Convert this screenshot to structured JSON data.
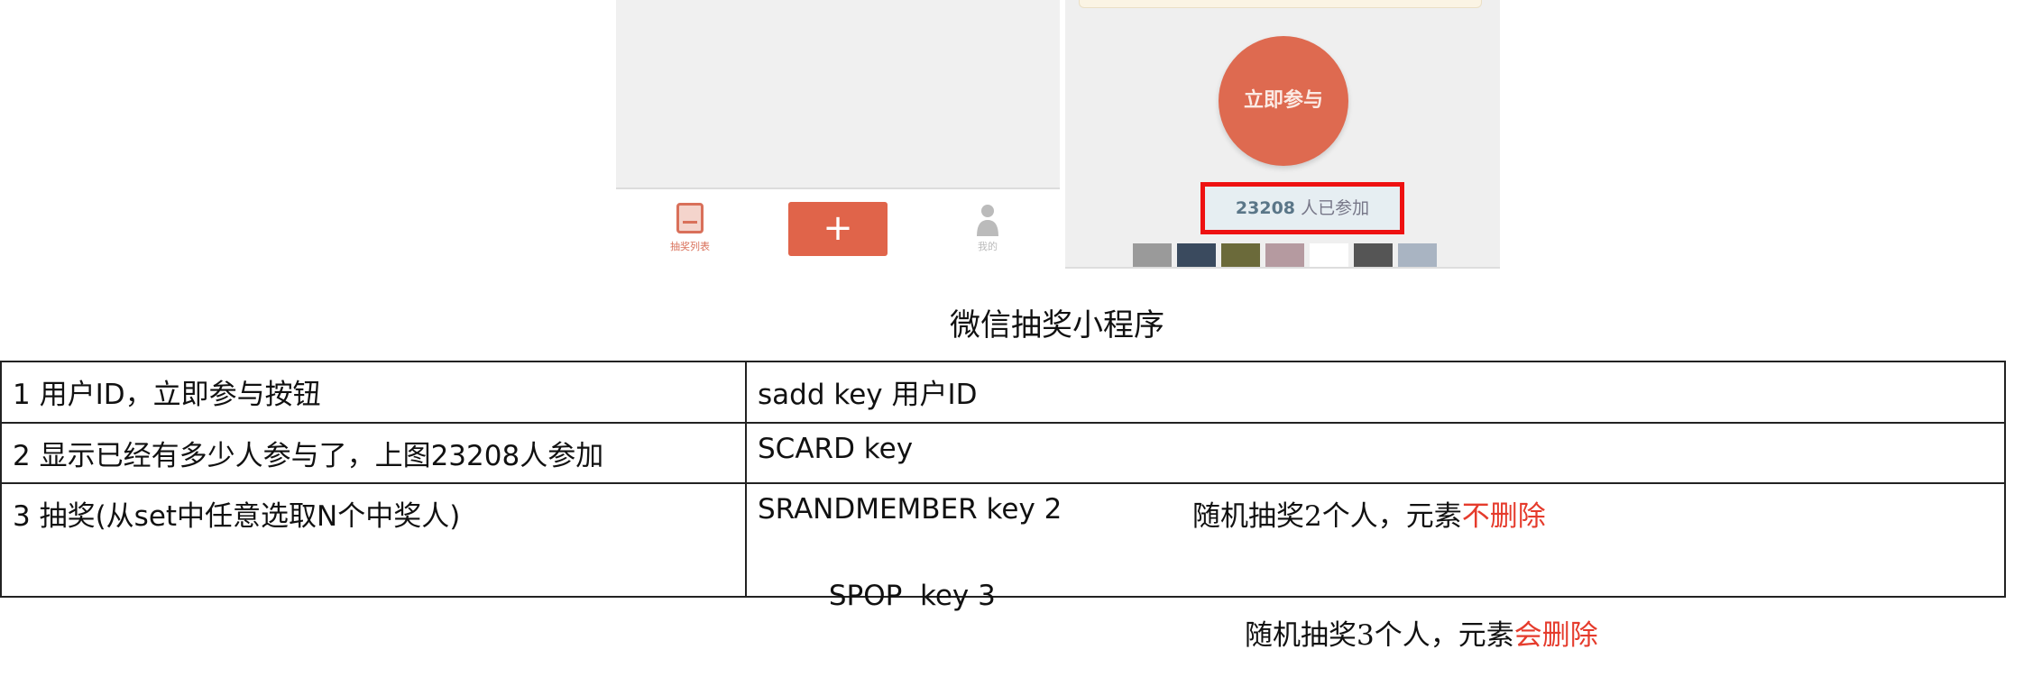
{
  "screenshot": {
    "join_button": "立即参与",
    "participant_count": "23208",
    "participant_suffix": "人已参加",
    "nav_left_label": "抽奖列表",
    "nav_plus": "+",
    "nav_right_label": "我的",
    "avatar_colors": [
      "#9a9a9a",
      "#3a4a5e",
      "#6b6a3a",
      "#b59aa0",
      "#ffffff",
      "#555555",
      "#a9b4c2"
    ]
  },
  "caption": "微信抽奖小程序",
  "table": {
    "rows": [
      {
        "desc": "1 用户ID，立即参与按钮",
        "cmd": "sadd key 用户ID"
      },
      {
        "desc": "2 显示已经有多少人参与了，上图23208人参加",
        "cmd": "SCARD key"
      },
      {
        "desc": "3 抽奖(从set中任意选取N个中奖人)",
        "lines": [
          {
            "cmd": "SRANDMEMBER key 2",
            "note": "随机抽奖2个人，元素",
            "note_red": "不删除"
          },
          {
            "cmd": "SPOP  key 3",
            "note": "随机抽奖3个人，元素",
            "note_red": "会删除"
          }
        ]
      }
    ]
  },
  "colors": {
    "accent": "#e0644a",
    "highlight_red": "#ee1111",
    "text_red": "#e53b2c"
  }
}
